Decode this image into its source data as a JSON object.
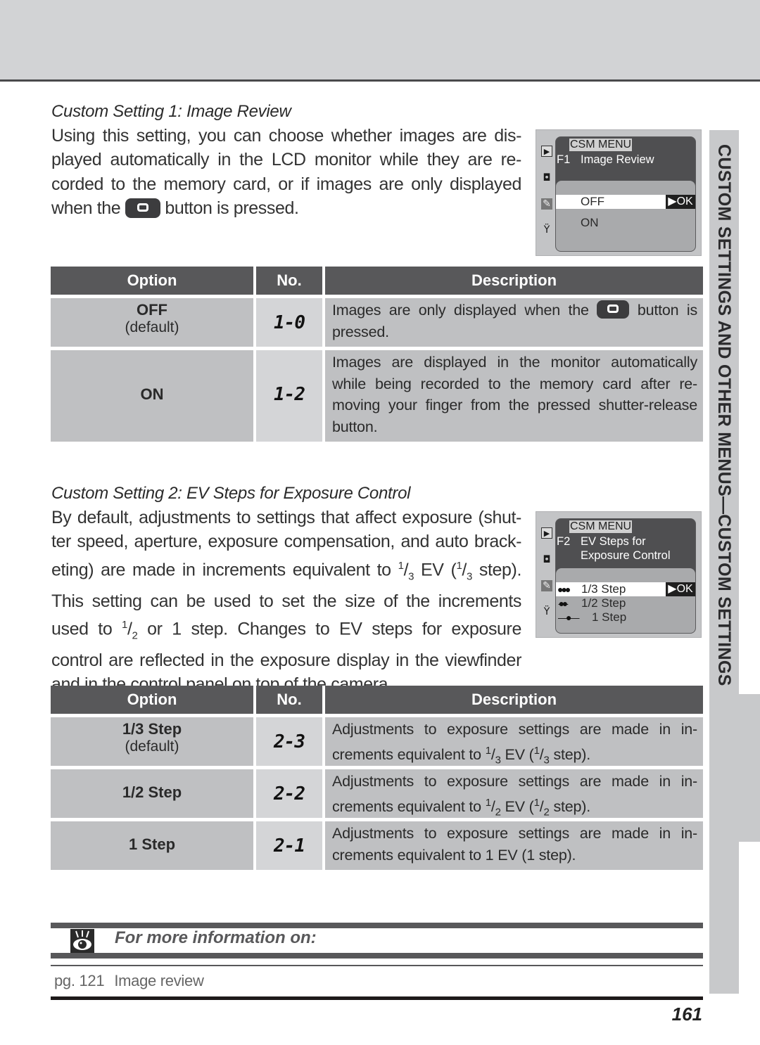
{
  "side_tab": {
    "label": "CUSTOM SETTINGS AND OTHER MENUS—CUSTOM SETTINGS"
  },
  "section1": {
    "title": "Custom Setting 1: Image Review",
    "body_lines": [
      "Using this setting, you can choose whether images are dis-",
      "played automatically in the LCD monitor while they are re-",
      "corded to the memory card, or if images are only displayed"
    ],
    "body_last_before": "when the",
    "body_last_after": "button is pressed.",
    "button_icon": "monitor-button-icon",
    "lcd": {
      "menu_label": "CSM MENU",
      "code": "F1",
      "title_lines": [
        "Image Review"
      ],
      "options": [
        {
          "label": "OFF",
          "selected": true
        },
        {
          "label": "ON",
          "selected": false
        }
      ],
      "ok_label": "▶OK",
      "side_icons": [
        "playback-icon",
        "camera-icon",
        "pencil-icon",
        "wrench-icon"
      ]
    },
    "table": {
      "headers": {
        "option": "Option",
        "no": "No.",
        "description": "Description"
      },
      "rows": [
        {
          "option": "OFF",
          "option_sub": "(default)",
          "no": "1-0",
          "desc_first_before": "Images are only displayed when the",
          "desc_first_after": "button is",
          "desc_lines": [
            "pressed."
          ]
        },
        {
          "option": "ON",
          "option_sub": "",
          "no": "1-2",
          "desc_lines": [
            "Images are displayed in the monitor automatically",
            "while being recorded to the memory card after re-",
            "moving your finger from the pressed shutter-release",
            "button."
          ]
        }
      ]
    }
  },
  "section2": {
    "title": "Custom Setting 2: EV Steps for Exposure Control",
    "body": {
      "l1": "By default, adjustments to settings that affect exposure (shut-",
      "l2": "ter speed, aperture, exposure compensation, and auto brack-",
      "l3a": "eting) are made in increments equivalent to ",
      "l3b": " EV (",
      "l3c": " step).",
      "l4": "This setting can be used to set the size of the increments",
      "l5a": "used to ",
      "l5b": " or 1 step.  Changes to EV steps for exposure",
      "l6": "control are reflected in the exposure display in the viewfinder",
      "l7": "and in the control panel on top of the camera.",
      "frac_num": "1",
      "frac_slash": "/",
      "frac_3": "3",
      "frac_2": "2"
    },
    "lcd": {
      "menu_label": "CSM MENU",
      "code": "F2",
      "title_lines": [
        "EV Steps for",
        "Exposure Control"
      ],
      "options": [
        {
          "label": "1/3 Step",
          "selected": true,
          "icon": "three-dots-icon"
        },
        {
          "label": "1/2 Step",
          "selected": false,
          "icon": "two-dots-icon"
        },
        {
          "label": "1 Step",
          "selected": false,
          "icon": "one-dot-icon"
        }
      ],
      "ok_label": "▶OK",
      "side_icons": [
        "playback-icon",
        "camera-icon",
        "pencil-icon",
        "wrench-icon"
      ]
    },
    "table": {
      "headers": {
        "option": "Option",
        "no": "No.",
        "description": "Description"
      },
      "rows": [
        {
          "option": "1/3 Step",
          "option_sub": "(default)",
          "no": "2-3",
          "desc_l1": "Adjustments to exposure settings are made in in-",
          "desc_l2a": "crements equivalent to ",
          "frac": "3",
          "desc_l2b": " EV (",
          "desc_l2c": " step)."
        },
        {
          "option": "1/2 Step",
          "option_sub": "",
          "no": "2-2",
          "desc_l1": "Adjustments to exposure settings are made in in-",
          "desc_l2a": "crements equivalent to ",
          "frac": "2",
          "desc_l2b": " EV (",
          "desc_l2c": " step)."
        },
        {
          "option": "1 Step",
          "option_sub": "",
          "no": "2-1",
          "desc_l1": "Adjustments to exposure settings are made in in-",
          "desc_l2": "crements equivalent to 1 EV (1 step)."
        }
      ]
    }
  },
  "more_info": {
    "title": "For more information on:",
    "refs": [
      {
        "page": "pg. 121",
        "label": "Image review"
      }
    ]
  },
  "page_number": "161"
}
